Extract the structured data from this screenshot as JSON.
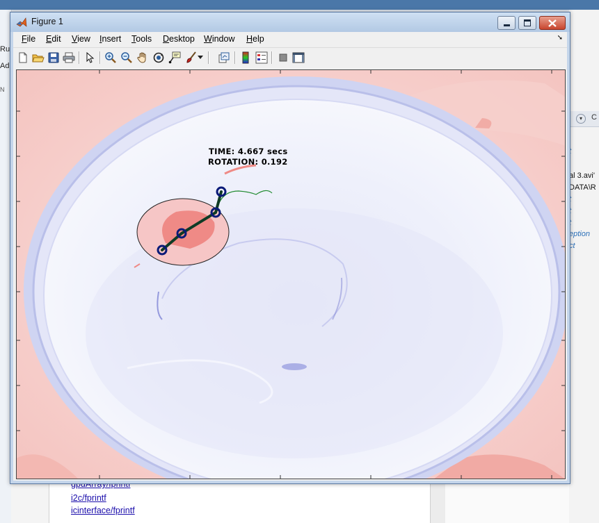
{
  "background": {
    "left_fragments": [
      "Ru",
      "Ad",
      "N"
    ],
    "right_fragments": [
      {
        "text": "t",
        "color": "#2a6fb8",
        "italic": true
      },
      {
        "text": "al 3.avi'",
        "color": "#111111",
        "italic": false
      },
      {
        "text": "DATA\\R",
        "color": "#111111",
        "italic": false
      },
      {
        "text": "t",
        "color": "#2a6fb8",
        "italic": true
      },
      {
        "text": "t",
        "color": "#2a6fb8",
        "italic": true
      },
      {
        "text": "t",
        "color": "#2a6fb8",
        "italic": true
      },
      {
        "text": "eption",
        "color": "#2a6fb8",
        "italic": true
      },
      {
        "text": "ct",
        "color": "#2a6fb8",
        "italic": true
      }
    ],
    "right_bar_label": "C",
    "doc_links": [
      "gpuArray/fprintf",
      "i2c/fprintf",
      "icinterface/fprintf"
    ]
  },
  "window": {
    "title": "Figure 1",
    "icon": "matlab-logo-icon",
    "controls": {
      "minimize": "minimize-icon",
      "maximize": "maximize-icon",
      "close": "close-icon"
    }
  },
  "menu": [
    {
      "label": "File",
      "mnemonic": "F",
      "rest": "ile"
    },
    {
      "label": "Edit",
      "mnemonic": "E",
      "rest": "dit"
    },
    {
      "label": "View",
      "mnemonic": "V",
      "rest": "iew"
    },
    {
      "label": "Insert",
      "mnemonic": "I",
      "rest": "nsert"
    },
    {
      "label": "Tools",
      "mnemonic": "T",
      "rest": "ools"
    },
    {
      "label": "Desktop",
      "mnemonic": "D",
      "rest": "esktop"
    },
    {
      "label": "Window",
      "mnemonic": "W",
      "rest": "indow"
    },
    {
      "label": "Help",
      "mnemonic": "H",
      "rest": "elp"
    }
  ],
  "toolbar": [
    "new-figure-icon",
    "open-file-icon",
    "save-icon",
    "print-icon",
    "edit-plot-arrow-icon",
    "zoom-in-icon",
    "zoom-out-icon",
    "pan-hand-icon",
    "rotate-3d-icon",
    "data-cursor-icon",
    "brush-icon",
    "brush-dropdown-icon",
    "link-plot-icon",
    "insert-colorbar-icon",
    "insert-legend-icon",
    "hide-plot-tools-icon",
    "show-plot-tools-icon"
  ],
  "plot": {
    "time_label": "TIME: 4.667 secs",
    "rotation_label": "ROTATION: 0.192",
    "colors": {
      "skeleton": "#0f3b25",
      "marker": "#0a1a78",
      "trajectory": "#1f8a2e",
      "ellipse_stroke": "#222222",
      "ellipse_fill": "#f6c6c6",
      "dish_rim": "#c7cdf0",
      "dish_inner": "#eef0fb",
      "background_red": "#f7d3d0"
    }
  }
}
